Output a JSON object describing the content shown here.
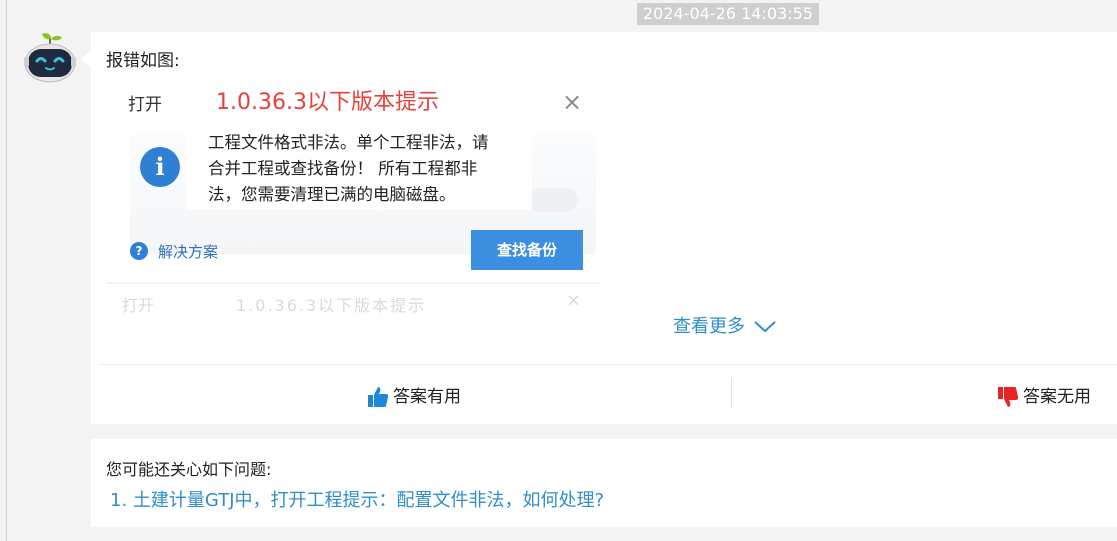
{
  "timestamp": "2024-04-26 14:03:55",
  "message": {
    "text": "报错如图:",
    "screenshot": {
      "dialog_title": "打开",
      "version_note": "1.0.36.3以下版本提示",
      "close_glyph": "×",
      "info_glyph": "i",
      "body_line1": "工程文件格式非法。单个工程非法，请",
      "body_line2": "合并工程或查找备份！ 所有工程都非",
      "body_line3": "法，您需要清理已满的电脑磁盘。",
      "help_glyph": "?",
      "help_link": "解决方案",
      "primary_button": "查找备份",
      "faded_title": "打开",
      "faded_text": "1.0.36.3以下版本提示",
      "faded_close": "×"
    },
    "see_more": "查看更多"
  },
  "feedback": {
    "useful": "答案有用",
    "useless": "答案无用"
  },
  "related": {
    "title": "您可能还关心如下问题:",
    "items": [
      "1. 土建计量GTJ中，打开工程提示：配置文件非法，如何处理?"
    ]
  },
  "colors": {
    "accent": "#2f8ec9",
    "thumb_up": "#1e88d8",
    "thumb_down": "#e82323",
    "version_note": "#e8403b"
  }
}
